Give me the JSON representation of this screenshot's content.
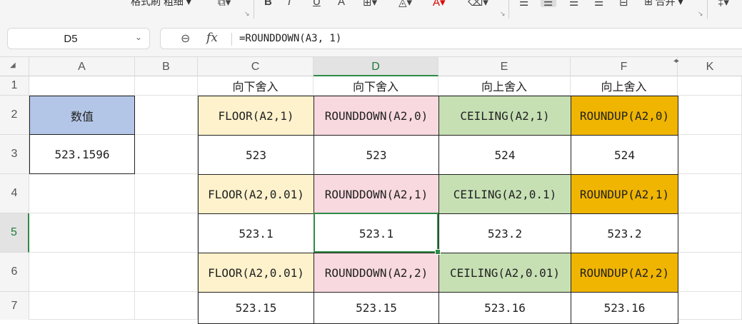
{
  "ribbon": {
    "format_painter_label": "格式刷",
    "font_size_label": "粗细",
    "merge_label": "合并",
    "icons": [
      "clear-format-icon",
      "bold-icon",
      "italic-icon",
      "underline-icon",
      "strikethrough-icon",
      "border-icon",
      "fill-color-icon",
      "font-color-icon",
      "erase-icon",
      "align-left-icon",
      "align-center-icon",
      "align-right-icon",
      "justify-icon",
      "wrap-icon",
      "merge-icon"
    ]
  },
  "formula_bar": {
    "name_box": "D5",
    "formula": "=ROUNDDOWN(A3, 1)"
  },
  "columns": [
    "A",
    "B",
    "C",
    "D",
    "E",
    "F",
    "K"
  ],
  "rows": [
    "1",
    "2",
    "3",
    "4",
    "5",
    "6",
    "7"
  ],
  "cells": {
    "C1": "向下舍入",
    "D1": "向下舍入",
    "E1": "向上舍入",
    "F1": "向上舍入",
    "A2": "数值",
    "C2": "FLOOR(A2,1)",
    "D2": "ROUNDDOWN(A2,0)",
    "E2": "CEILING(A2,1)",
    "F2": "ROUNDUP(A2,0)",
    "A3": "523.1596",
    "C3": "523",
    "D3": "523",
    "E3": "524",
    "F3": "524",
    "C4": "FLOOR(A2,0.01)",
    "D4": "ROUNDDOWN(A2,1)",
    "E4": "CEILING(A2,0.1)",
    "F4": "ROUNDUP(A2,1)",
    "C5": "523.1",
    "D5": "523.1",
    "E5": "523.2",
    "F5": "523.2",
    "C6": "FLOOR(A2,0.01)",
    "D6": "ROUNDDOWN(A2,2)",
    "E6": "CEILING(A2,0.01)",
    "F6": "ROUNDUP(A2,2)",
    "C7": "523.15",
    "D7": "523.15",
    "E7": "523.16",
    "F7": "523.16"
  },
  "colors": {
    "accent_green": "#2e8a46",
    "floor_fill": "#fdf2cc",
    "rounddown_fill": "#f8d9df",
    "ceiling_fill": "#c6e0b4",
    "roundup_fill": "#f0b500",
    "label_fill": "#b4c6e7"
  }
}
